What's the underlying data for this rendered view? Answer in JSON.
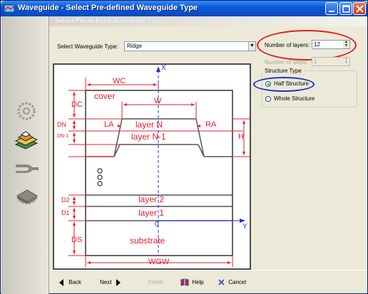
{
  "window": {
    "title": "Waveguide - Select Pre-defined Waveguide Type"
  },
  "header": {
    "title": "Select Pre-defined Waveguide Type"
  },
  "form": {
    "waveguide_type_label": "Select Waveguide Type:",
    "waveguide_type_value": "Ridge",
    "num_layers_label": "Number of layers:",
    "num_layers_value": "12",
    "num_steps_label": "Number of steps:",
    "num_steps_value": "1",
    "structure_type_label": "Structure Type",
    "half_structure_label": "Half Structure",
    "whole_structure_label": "Whole Structure",
    "selected_structure": "Half Structure"
  },
  "diagram": {
    "axis_x": "X",
    "axis_y": "Y",
    "origin": "0",
    "wc": "WC",
    "w": "W",
    "wgw": "WGW",
    "dc": "DC",
    "dn": "DN",
    "dn1": "DN-1",
    "d2": "D2",
    "d1": "D1",
    "ds": "DS",
    "la": "LA",
    "ra": "RA",
    "h": "H",
    "cover": "cover",
    "layer_n": "layer N",
    "layer_n1": "layer N-1",
    "layer_2": "layer 2",
    "layer_1": "layer 1",
    "substrate": "substrate"
  },
  "footer": {
    "back": "Back",
    "next": "Next",
    "finish": "Finish",
    "help": "Help",
    "cancel": "Cancel"
  },
  "colors": {
    "title_bar": "#0a58d8",
    "diagram_red": "#e0202a",
    "diagram_blue": "#2030e0",
    "highlight_red": "#e0202a",
    "highlight_blue": "#1a2fd0"
  },
  "icons": {
    "sidebar": [
      "ring-resonator-icon",
      "waveguide-layers-icon",
      "coupler-icon",
      "chip-icon"
    ]
  }
}
